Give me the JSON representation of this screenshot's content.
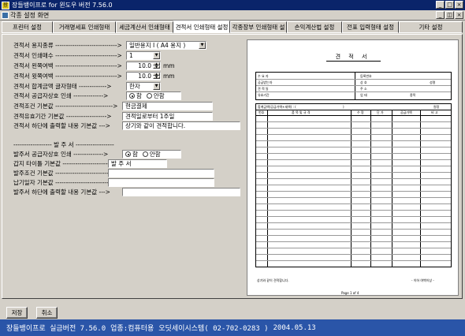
{
  "window": {
    "title": "장들뱅이프로 for 윈도우 버전 7.56.0",
    "child_title": "각종 설정 화면",
    "min": "_",
    "max": "□",
    "close": "×",
    "mdi_min": "_",
    "mdi_restore": "◫",
    "mdi_close": "×"
  },
  "tabs": [
    {
      "label": "프린터 설정"
    },
    {
      "label": "거래명세표 인쇄형태"
    },
    {
      "label": "세금계산서 인쇄형태"
    },
    {
      "label": "견적서 인쇄형태 설정"
    },
    {
      "label": "각종장부 인쇄형태 설"
    },
    {
      "label": "손익계산법 설정"
    },
    {
      "label": "전표 입력형태 설정"
    },
    {
      "label": "기타 설정"
    }
  ],
  "form": {
    "paper_label": "견적서 용지종류 ----------------------------->",
    "paper_value": "일반용지 I ( A4 용지 )",
    "copies_label": "견적서 인쇄매수 ----------------------------->",
    "copies_value": "1",
    "left_margin_label": "견적서 왼쪽여백 ----------------------------->",
    "left_margin_value": "10.0",
    "top_margin_label": "견적서 윗쪽여백 ----------------------------->",
    "top_margin_value": "10.0",
    "unit_mm": "mm",
    "total_format_label": "견적서 합계금액 글자형태 ------------->",
    "total_format_value": "한자",
    "supplier_label": "견적서 공급자상호 인쇄 -------------->",
    "radio_yes": "함",
    "radio_no": "안함",
    "condition_label": "견적조건 기본값 --------------------------->",
    "condition_value": "현금결제",
    "validity_label": "견적유효기간 기본값 ------------------->",
    "validity_value": "견적일로부터 1주일",
    "footer_label": "견적서 하단에 출력할 내용 기본값 --->",
    "footer_value": "상기와 같이 견적합니다.",
    "order_sep": "------------------  발 주 서  ------------------",
    "po_supplier_label": "발주서 공급자상호 인쇄 -------------->",
    "po_title_label": "갑지 타이틀 기본값 ----------------------->",
    "po_title_value": "발   주   서",
    "po_condition_label": "발주조건 기본값 ------------------------->",
    "po_condition_value": "",
    "delivery_label": "납기일자 기본값 --------------------------->",
    "delivery_value": "",
    "po_footer_label": "발주서 하단에 출력할 내용 기본값 --->",
    "po_footer_value": ""
  },
  "preview": {
    "title": "견 적 서",
    "table_header_left": "합계금액(공급가액+세액) :  (",
    "table_header_right": ")",
    "table_header_won": "원정",
    "col_no": "번호",
    "col_item": "품 목 및 규 격",
    "col_qty": "수 량",
    "col_price": "단 가",
    "col_amount": "공급가액",
    "col_note": "비 고",
    "footer_left": "상기와 같이 견적합니다.",
    "footer_right": "- 이하 여백이상 -",
    "page": "Page 1 of 4",
    "hdr_a": "수 요 자",
    "hdr_b": "공급받는자",
    "hdr_c": "견 적 일",
    "hdr_d": "유효기간",
    "hdr_e": "등록번호",
    "hdr_f": "상 호",
    "hdr_g": "주 소",
    "hdr_h": "업 태",
    "hdr_i": "성명",
    "hdr_j": "종목"
  },
  "buttons": {
    "save": "저장",
    "cancel": "취소"
  },
  "status": {
    "product": "장들뱅이프로 실금버전 7.56.0",
    "usage": "업종:컴퓨터용",
    "company": "오딧세이시스템( 02-702-0283 )",
    "date": "2004.05.13"
  }
}
